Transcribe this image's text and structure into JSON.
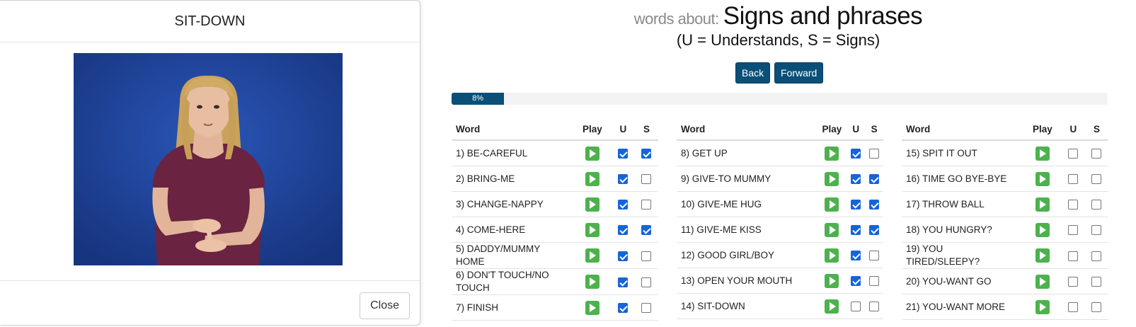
{
  "modal": {
    "title": "SIT-DOWN",
    "close_label": "Close"
  },
  "header": {
    "prefix": "words about:",
    "title": "Signs and phrases",
    "subtitle": "(U = Understands, S = Signs)"
  },
  "nav": {
    "back_label": "Back",
    "forward_label": "Forward"
  },
  "progress": {
    "percent": 8,
    "label": "8%"
  },
  "columns": {
    "word": "Word",
    "play": "Play",
    "u": "U",
    "s": "S"
  },
  "tables": [
    [
      {
        "word": "1) BE-CAREFUL",
        "u": true,
        "s": true
      },
      {
        "word": "2) BRING-ME",
        "u": true,
        "s": false
      },
      {
        "word": "3) CHANGE-NAPPY",
        "u": true,
        "s": false
      },
      {
        "word": "4) COME-HERE",
        "u": true,
        "s": true
      },
      {
        "word": "5) DADDY/MUMMY HOME",
        "u": true,
        "s": false
      },
      {
        "word": "6) DON'T TOUCH/NO TOUCH",
        "u": true,
        "s": false
      },
      {
        "word": "7) FINISH",
        "u": true,
        "s": false
      }
    ],
    [
      {
        "word": "8) GET UP",
        "u": true,
        "s": false
      },
      {
        "word": "9) GIVE-TO MUMMY",
        "u": true,
        "s": true
      },
      {
        "word": "10) GIVE-ME HUG",
        "u": true,
        "s": true
      },
      {
        "word": "11) GIVE-ME KISS",
        "u": true,
        "s": true
      },
      {
        "word": "12) GOOD GIRL/BOY",
        "u": true,
        "s": false
      },
      {
        "word": "13) OPEN YOUR MOUTH",
        "u": true,
        "s": false
      },
      {
        "word": "14) SIT-DOWN",
        "u": false,
        "s": false
      }
    ],
    [
      {
        "word": "15) SPIT IT OUT",
        "u": false,
        "s": false
      },
      {
        "word": "16) TIME GO BYE-BYE",
        "u": false,
        "s": false
      },
      {
        "word": "17) THROW BALL",
        "u": false,
        "s": false
      },
      {
        "word": "18) YOU HUNGRY?",
        "u": false,
        "s": false
      },
      {
        "word": "19) YOU TIRED/SLEEPY?",
        "u": false,
        "s": false
      },
      {
        "word": "20) YOU-WANT GO",
        "u": false,
        "s": false
      },
      {
        "word": "21) YOU-WANT MORE",
        "u": false,
        "s": false
      }
    ]
  ],
  "icons": {
    "play": "play-icon",
    "checkbox": "checkbox-icon"
  },
  "colors": {
    "primary": "#0a4f78",
    "play_green": "#4db24d",
    "checkbox_blue": "#1565d8",
    "video_background": "#1b3f9a"
  }
}
